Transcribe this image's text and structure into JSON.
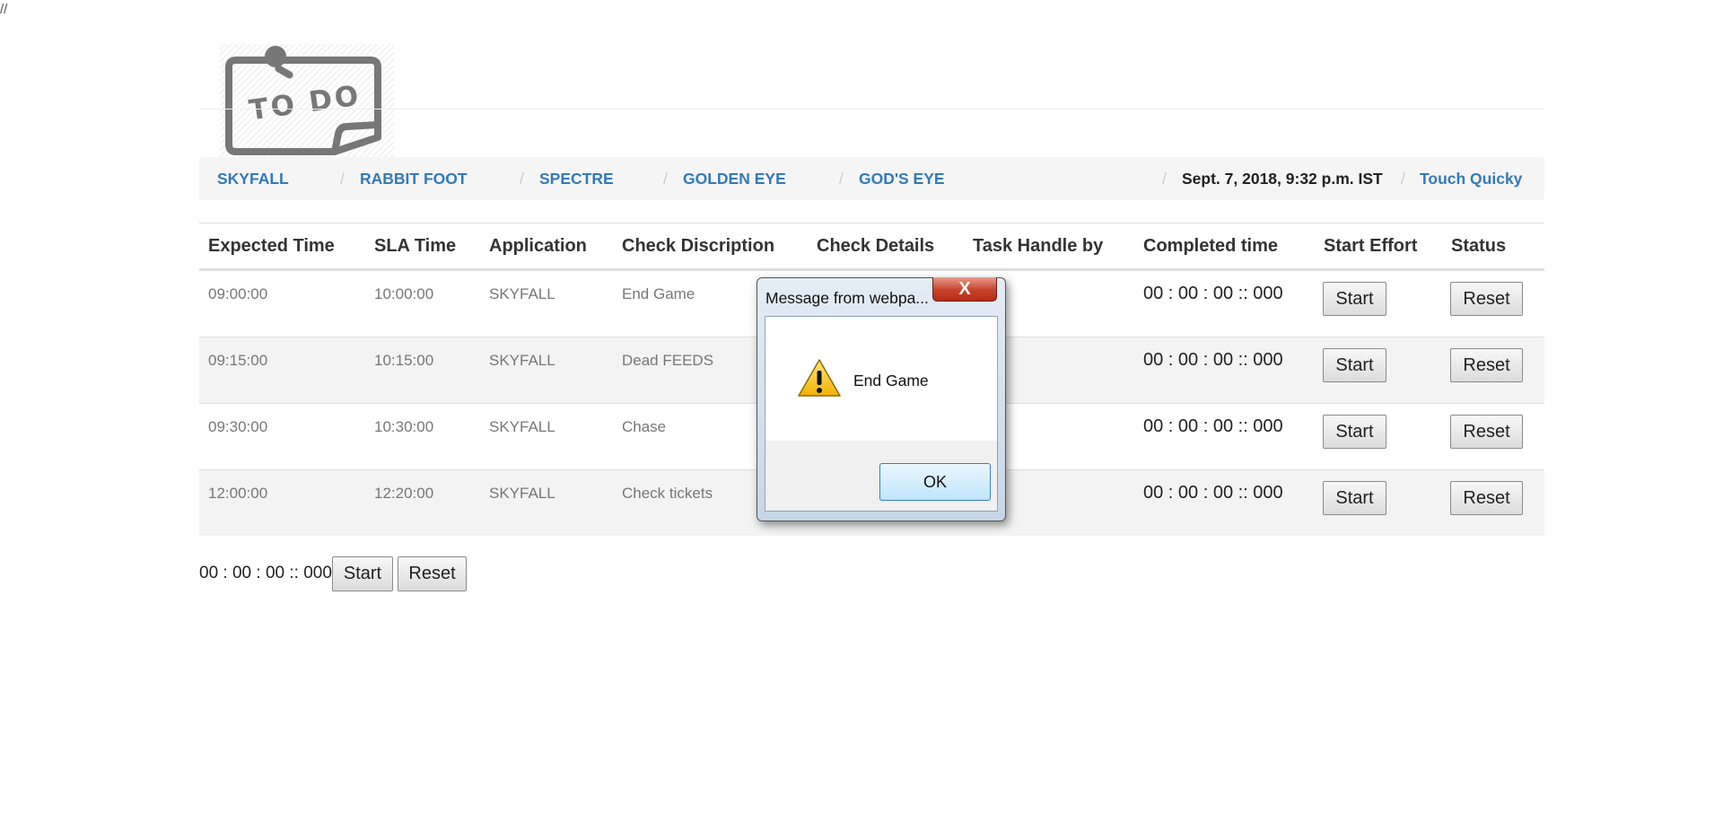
{
  "page_marker": "//",
  "logo": {
    "text": "TO DO"
  },
  "nav": {
    "items": [
      "SKYFALL",
      "RABBIT FOOT",
      "SPECTRE",
      "GOLDEN EYE",
      "GOD'S EYE"
    ],
    "separator": "/",
    "datetime": "Sept. 7, 2018, 9:32 p.m. IST",
    "user": "Touch Quicky"
  },
  "table": {
    "headers": [
      "Expected Time",
      "SLA Time",
      "Application",
      "Check Discription",
      "Check Details",
      "Task Handle by",
      "Completed time",
      "Start Effort",
      "Status"
    ],
    "rows": [
      {
        "expected": "09:00:00",
        "sla": "10:00:00",
        "app": "SKYFALL",
        "desc": "End Game",
        "completed": "00 : 00 : 00 :: 000",
        "start": "Start",
        "reset": "Reset"
      },
      {
        "expected": "09:15:00",
        "sla": "10:15:00",
        "app": "SKYFALL",
        "desc": "Dead FEEDS",
        "completed": "00 : 00 : 00 :: 000",
        "start": "Start",
        "reset": "Reset"
      },
      {
        "expected": "09:30:00",
        "sla": "10:30:00",
        "app": "SKYFALL",
        "desc": "Chase",
        "completed": "00 : 00 : 00 :: 000",
        "start": "Start",
        "reset": "Reset"
      },
      {
        "expected": "12:00:00",
        "sla": "12:20:00",
        "app": "SKYFALL",
        "desc": "Check tickets",
        "completed": "00 : 00 : 00 :: 000",
        "start": "Start",
        "reset": "Reset"
      }
    ]
  },
  "footer": {
    "timer": "00 : 00 : 00 :: 000",
    "start": "Start",
    "reset": "Reset"
  },
  "dialog": {
    "title": "Message from webpa...",
    "close": "X",
    "message": "End Game",
    "ok": "OK",
    "icon": "warning-icon"
  }
}
